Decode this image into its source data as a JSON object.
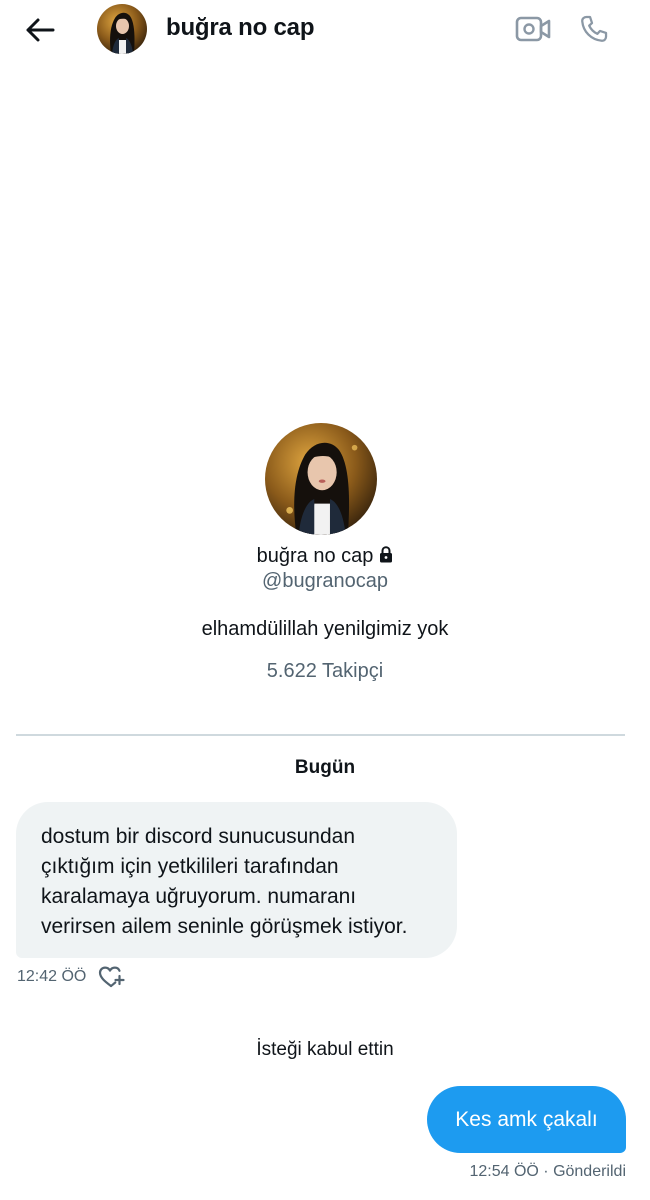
{
  "header": {
    "title": "buğra no cap",
    "back_icon": "arrow-left-icon",
    "video_icon": "video-call-icon",
    "call_icon": "phone-icon"
  },
  "profile": {
    "name": "buğra no cap",
    "protected_icon": "lock-icon",
    "handle": "@bugranocap",
    "bio": "elhamdülillah yenilgimiz yok",
    "followers": "5.622 Takipçi"
  },
  "conversation": {
    "date_label": "Bugün",
    "incoming": {
      "lines": [
        "dostum bir discord sunucusundan",
        "çıktığım için yetkilileri tarafından",
        "karalamaya uğruyorum. numaranı",
        "verirsen ailem seninle görüşmek istiyor."
      ],
      "time": "12:42 ÖÖ",
      "react_icon": "heart-plus-icon"
    },
    "system_message": "İsteği kabul ettin",
    "outgoing": {
      "text": "Kes amk çakalı",
      "meta": "12:54 ÖÖ · Gönderildi"
    }
  },
  "colors": {
    "accent": "#1d9bf0",
    "incoming_bubble": "#eff3f4",
    "secondary_text": "#536471",
    "divider": "#cfd9de"
  }
}
